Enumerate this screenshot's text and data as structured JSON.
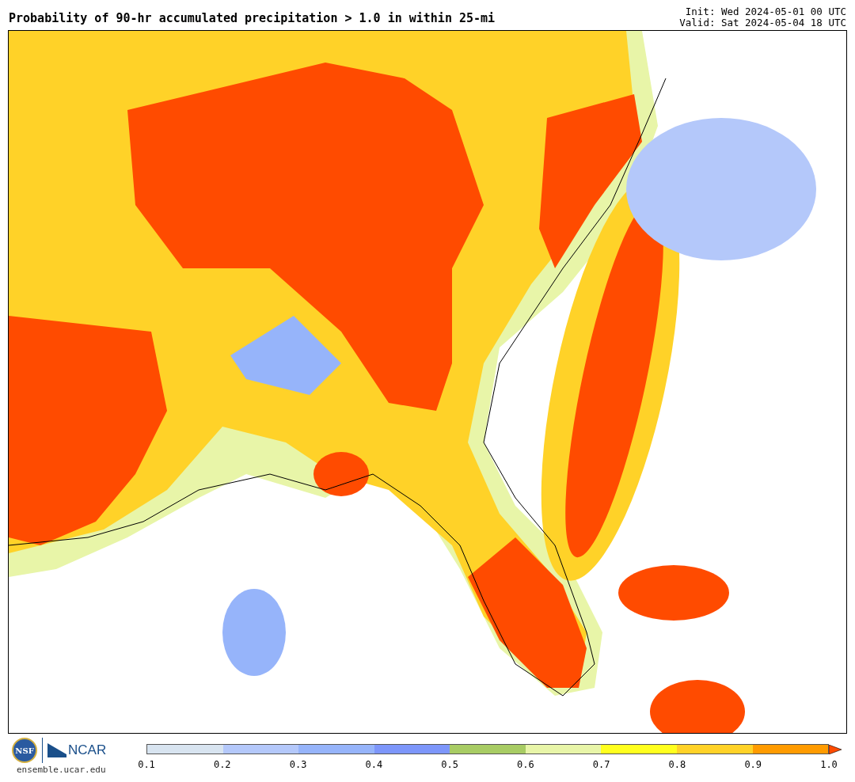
{
  "title": "Probability of 90-hr accumulated precipitation > 1.0 in within 25-mi",
  "init": "Init: Wed 2024-05-01 00 UTC",
  "valid": "Valid: Sat 2024-05-04 18 UTC",
  "logos": {
    "nsf": "NSF",
    "ncar": "NCAR",
    "url": "ensemble.ucar.edu"
  },
  "colorbar": {
    "bins": [
      {
        "kind": "bin",
        "color": "#d8e4f0"
      },
      {
        "kind": "bin",
        "color": "#b4c8fa"
      },
      {
        "kind": "bin",
        "color": "#96b4fa"
      },
      {
        "kind": "bin",
        "color": "#7d96fa"
      },
      {
        "kind": "bin",
        "color": "#a8cc64"
      },
      {
        "kind": "bin",
        "color": "#e8f5a8"
      },
      {
        "kind": "bin",
        "color": "#ffff1e"
      },
      {
        "kind": "bin",
        "color": "#ffd228"
      },
      {
        "kind": "bin",
        "color": "#ff9b00"
      },
      {
        "kind": "arrow",
        "color": "#ff4b00"
      }
    ],
    "ticks": [
      "0.1",
      "0.2",
      "0.3",
      "0.4",
      "0.5",
      "0.6",
      "0.7",
      "0.8",
      "0.9",
      "1.0"
    ]
  }
}
